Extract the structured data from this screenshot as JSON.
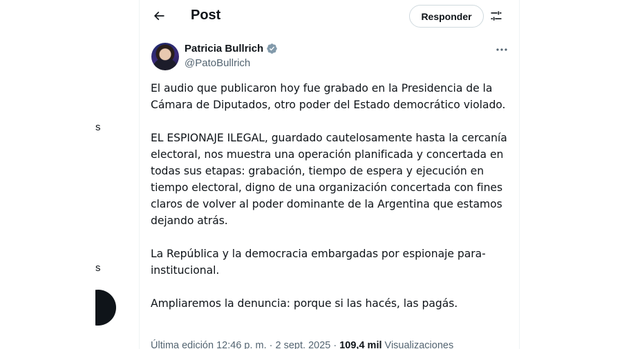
{
  "left_sidebar": {
    "fragment_1": "s",
    "fragment_2": "s"
  },
  "header": {
    "title": "Post",
    "reply_label": "Responder"
  },
  "author": {
    "name": "Patricia Bullrich",
    "handle": "@PatoBullrich"
  },
  "tweet": {
    "paragraphs": [
      "El audio que publicaron hoy fue grabado en la Presidencia de la Cámara de Diputados, otro poder del Estado democrático violado.",
      "EL ESPIONAJE ILEGAL, guardado cautelosamente hasta la cercanía electoral, nos muestra una operación planificada y concertada en todas sus etapas: grabación, tiempo de espera y ejecución en tiempo electoral, digno de una organización concertada con fines claros de volver al poder dominante de la Argentina que estamos dejando atrás.",
      "La República y la democracia embargadas por espionaje para-institucional.",
      "Ampliaremos la denuncia: porque si las hacés, las pagás."
    ]
  },
  "meta": {
    "edited": "Última edición 12:46 p. m. · 2 sept. 2025 · ",
    "views_count": "109,4 mil",
    "views_label": " Visualizaciones"
  },
  "colors": {
    "text": "#0f1419",
    "secondary": "#536471",
    "verified": "#829aab",
    "border": "#cfd9de"
  },
  "icons": [
    "back-arrow-icon",
    "settings-icon",
    "verified-badge-icon",
    "more-icon"
  ]
}
